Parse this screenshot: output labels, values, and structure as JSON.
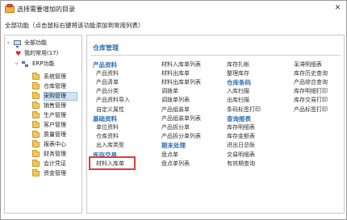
{
  "window": {
    "title": "选择需要增加的目录",
    "close_glyph": "✕",
    "instruction": "全部功能（点击鼠标右键将该功能添加到常用列表）"
  },
  "tree": {
    "root": "全部功能",
    "favorites": "我的常用(17)",
    "erp": "ERP功能",
    "items": [
      "系统管理",
      "仓库管理",
      "采购管理",
      "销售管理",
      "生产管理",
      "客户管理",
      "质量管理",
      "报表中心",
      "财务管理",
      "会计凭证",
      "资金管理"
    ],
    "selected_index": 1
  },
  "panel": {
    "title": "仓库管理",
    "columns": [
      [
        {
          "t": "产品资料",
          "s": true
        },
        {
          "t": "产品资料",
          "s": false
        },
        {
          "t": "产品清单",
          "s": false
        },
        {
          "t": "产品分类",
          "s": false
        },
        {
          "t": "产品资料导入",
          "s": false
        },
        {
          "t": "自定义属性",
          "s": false
        },
        {
          "t": "基础资料",
          "s": true
        },
        {
          "t": "单位资料",
          "s": false
        },
        {
          "t": "仓库资料",
          "s": false
        },
        {
          "t": "出入库类型",
          "s": false
        },
        {
          "t": "库存交易",
          "s": true
        },
        {
          "t": "材料入库单",
          "s": false
        }
      ],
      [
        {
          "t": "材料入库单列表",
          "s": false
        },
        {
          "t": "材料出库单",
          "s": false
        },
        {
          "t": "材料出库单列表",
          "s": false
        },
        {
          "t": "调拨单",
          "s": false
        },
        {
          "t": "调拨单列表",
          "s": false
        },
        {
          "t": "产品组装单",
          "s": false
        },
        {
          "t": "产品组装单列表",
          "s": false
        },
        {
          "t": "产品拆分单",
          "s": false
        },
        {
          "t": "产品拆分单列表",
          "s": false
        },
        {
          "t": "期末处理",
          "s": true
        },
        {
          "t": "盘点单",
          "s": false
        },
        {
          "t": "盘点单列表",
          "s": false
        }
      ],
      [
        {
          "t": "库存扎帐",
          "s": false
        },
        {
          "t": "整理库存",
          "s": false
        },
        {
          "t": "仓库条码",
          "s": true
        },
        {
          "t": "入库扫描",
          "s": false
        },
        {
          "t": "出库扫描",
          "s": false
        },
        {
          "t": "条码标签打印",
          "s": false
        },
        {
          "t": "查询报表",
          "s": true
        },
        {
          "t": "库存明细表",
          "s": false
        },
        {
          "t": "库存金额表",
          "s": false
        },
        {
          "t": "进出日总账",
          "s": false
        },
        {
          "t": "交易明细表",
          "s": false
        },
        {
          "t": "有效期查询",
          "s": false
        }
      ],
      [
        {
          "t": "呆滞明细表",
          "s": false
        },
        {
          "t": "库存历史查询",
          "s": false
        },
        {
          "t": "产品综合查询",
          "s": false
        },
        {
          "t": "库存明细打印",
          "s": false
        },
        {
          "t": "库存交易打印",
          "s": false
        },
        {
          "t": "产品标签打印",
          "s": false
        }
      ]
    ],
    "highlighted": "材料入库单"
  },
  "colors": {
    "accent": "#2f6fb5",
    "highlight_border": "#e23b3b",
    "selection": "#cfe3f5"
  }
}
